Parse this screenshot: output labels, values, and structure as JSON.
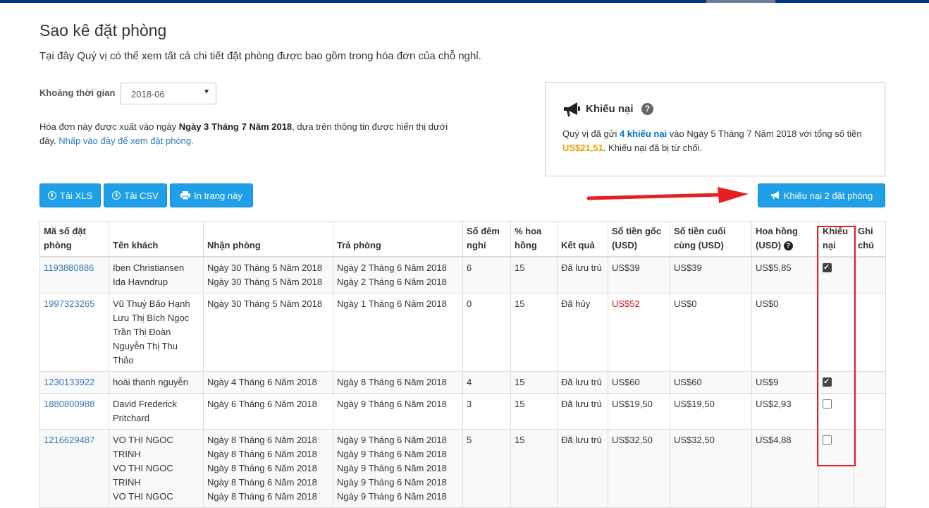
{
  "header": {
    "title": "Sao kê đặt phòng",
    "description": "Tại đây Quý vị có thể xem tất cả chi tiết đặt phòng được bao gồm trong hóa đơn của chỗ nghỉ."
  },
  "filter": {
    "label": "Khoảng thời gian",
    "selected": "2018-06"
  },
  "invoice_note": {
    "prefix": "Hóa đơn này được xuất vào ngày ",
    "date": "Ngày 3 Tháng 7 Năm 2018",
    "middle": ", dựa trên thông tin được hiển thị dưới đây. ",
    "link": "Nhấp vào đây để xem đặt phòng."
  },
  "complaint_box": {
    "title": "Khiếu nại",
    "text_1": "Quý vị đã gửi ",
    "count": "4 khiếu nại",
    "text_2": " vào Ngày 5 Tháng 7 Năm 2018 với tổng số tiền ",
    "amount": "US$21,51",
    "text_3": ". Khiếu nại đã bị từ chối."
  },
  "toolbar": {
    "xls": "Tải XLS",
    "csv": "Tải CSV",
    "print": "In trang này",
    "complain": "Khiếu nại 2 đặt phòng"
  },
  "table": {
    "headers": {
      "id": "Mã số đặt phòng",
      "guest": "Tên khách",
      "checkin": "Nhận phòng",
      "checkout": "Trả phòng",
      "nights": "Số đêm nghỉ",
      "rate": "% hoa hồng",
      "result": "Kết quả",
      "original": "Số tiền gốc (USD)",
      "final": "Số tiền cuối cùng (USD)",
      "commission": "Hoa hồng (USD)",
      "complaint": "Khiếu nại",
      "note": "Ghi chú"
    },
    "rows": [
      {
        "id": "1193880886",
        "guests": [
          "Iben Christiansen",
          "Ida Havndrup"
        ],
        "checkin": [
          "Ngày 30 Tháng 5 Năm 2018",
          "Ngày 30 Tháng 5 Năm 2018"
        ],
        "checkout": [
          "Ngày 2 Tháng 6 Năm 2018",
          "Ngày 2 Tháng 6 Năm 2018"
        ],
        "nights": "6",
        "rate": "15",
        "result": "Đã lưu trú",
        "original": "US$39",
        "final": "US$39",
        "commission": "US$5,85",
        "complaint": "checked"
      },
      {
        "id": "1997323265",
        "guests": [
          "Vũ Thuỷ Bảo Hạnh",
          "Lưu Thị Bích Ngọc",
          "Trần Thị Đoàn",
          "Nguyễn Thị Thu Thảo"
        ],
        "checkin": [
          "Ngày 30 Tháng 5 Năm 2018"
        ],
        "checkout": [
          "Ngày 1 Tháng 6 Năm 2018"
        ],
        "nights": "0",
        "rate": "15",
        "result": "Đã hủy",
        "original": "US$52",
        "final": "US$0",
        "commission": "US$0",
        "complaint": "none"
      },
      {
        "id": "1230133922",
        "guests": [
          "hoài thanh nguyễn"
        ],
        "checkin": [
          "Ngày 4 Tháng 6 Năm 2018"
        ],
        "checkout": [
          "Ngày 8 Tháng 6 Năm 2018"
        ],
        "nights": "4",
        "rate": "15",
        "result": "Đã lưu trú",
        "original": "US$60",
        "final": "US$60",
        "commission": "US$9",
        "complaint": "checked"
      },
      {
        "id": "1880800988",
        "guests": [
          "David Frederick Pritchard"
        ],
        "checkin": [
          "Ngày 6 Tháng 6 Năm 2018"
        ],
        "checkout": [
          "Ngày 9 Tháng 6 Năm 2018"
        ],
        "nights": "3",
        "rate": "15",
        "result": "Đã lưu trú",
        "original": "US$19,50",
        "final": "US$19,50",
        "commission": "US$2,93",
        "complaint": "unchecked"
      },
      {
        "id": "1216629487",
        "guests": [
          "VO THI NGOC TRINH",
          "VO THI NGOC TRINH",
          "VO THI NGOC"
        ],
        "checkin": [
          "Ngày 8 Tháng 6 Năm 2018",
          "Ngày 8 Tháng 6 Năm 2018",
          "Ngày 8 Tháng 6 Năm 2018",
          "Ngày 8 Tháng 6 Năm 2018",
          "Ngày 8 Tháng 6 Năm 2018"
        ],
        "checkout": [
          "Ngày 9 Tháng 6 Năm 2018",
          "Ngày 9 Tháng 6 Năm 2018",
          "Ngày 9 Tháng 6 Năm 2018",
          "Ngày 9 Tháng 6 Năm 2018",
          "Ngày 9 Tháng 6 Năm 2018"
        ],
        "nights": "5",
        "rate": "15",
        "result": "Đã lưu trú",
        "original": "US$32,50",
        "final": "US$32,50",
        "commission": "US$4,88",
        "complaint": "unchecked"
      }
    ]
  },
  "colors": {
    "primary_button": "#1e9fe8",
    "link": "#337ab7",
    "highlight": "#e52025",
    "amount": "#e4a000",
    "negative": "#d4111e"
  }
}
